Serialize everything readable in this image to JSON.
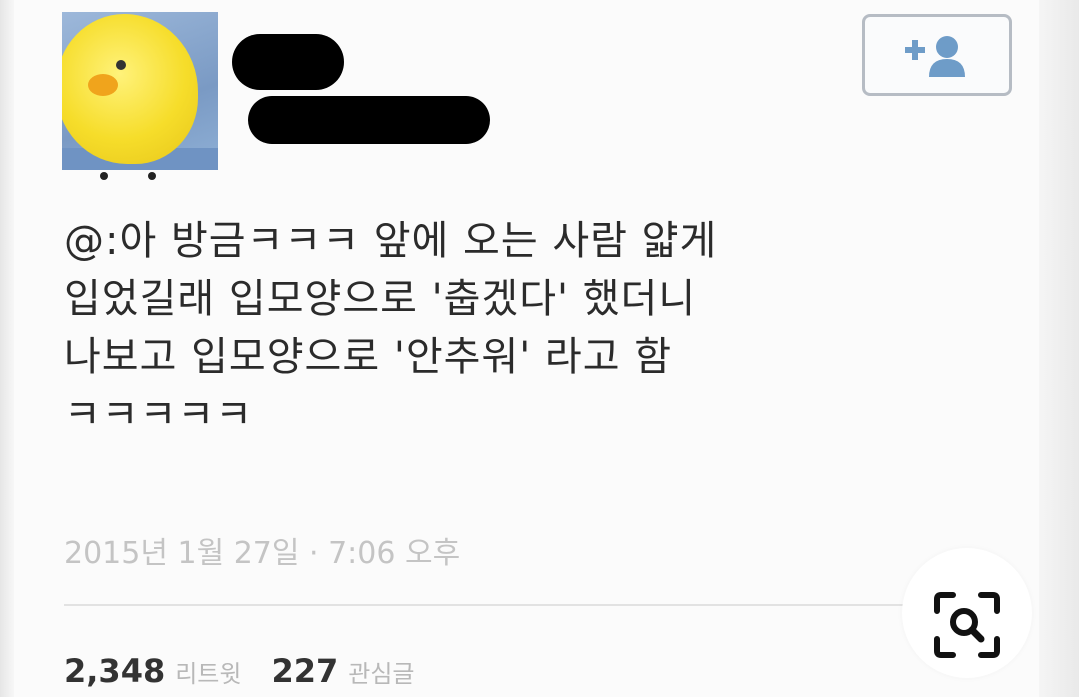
{
  "tweet": {
    "text": "@:아 방금ㅋㅋㅋ 앞에 오는 사람 얇게\n입었길래 입모양으로 '춥겠다' 했더니\n나보고 입모양으로 '안추워' 라고 함\nㅋㅋㅋㅋㅋ",
    "timestamp": "2015년 1월 27일 · 7:06 오후"
  },
  "stats": {
    "retweets_count": "2,348",
    "retweets_label": "리트윗",
    "favorites_count": "227",
    "favorites_label": "관심글"
  },
  "icons": {
    "follow": "add-user-icon",
    "zoom": "search-icon"
  },
  "colors": {
    "text": "#2b2b2b",
    "muted": "#c4c4c4",
    "button_border": "#b6bcc4",
    "avatar_yellow": "#f6dd2a"
  }
}
